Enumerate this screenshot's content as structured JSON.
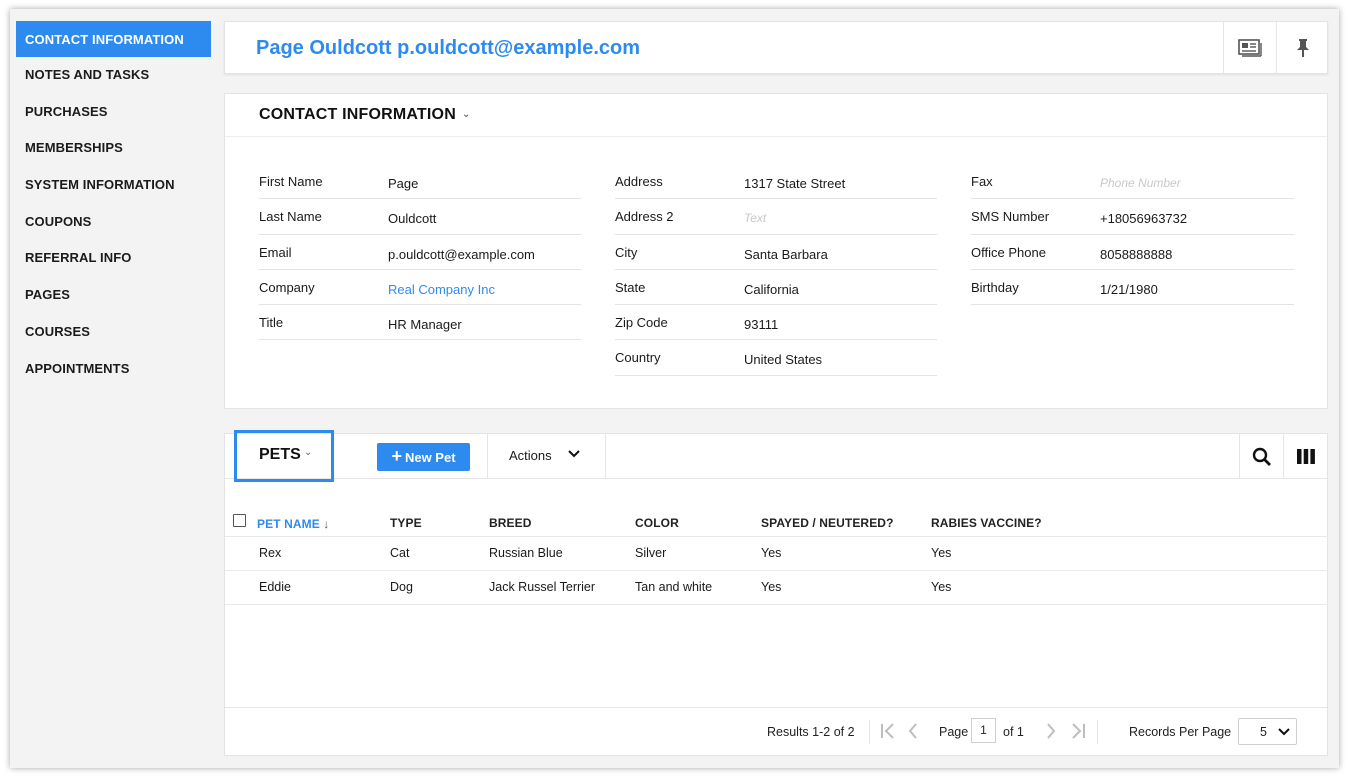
{
  "sidebar": {
    "items": [
      {
        "label": "CONTACT INFORMATION",
        "active": true
      },
      {
        "label": "NOTES AND TASKS"
      },
      {
        "label": "PURCHASES"
      },
      {
        "label": "MEMBERSHIPS"
      },
      {
        "label": "SYSTEM INFORMATION"
      },
      {
        "label": "COUPONS"
      },
      {
        "label": "REFERRAL INFO"
      },
      {
        "label": "PAGES"
      },
      {
        "label": "COURSES"
      },
      {
        "label": "APPOINTMENTS"
      }
    ]
  },
  "header": {
    "title": "Page Ouldcott p.ouldcott@example.com",
    "icons": [
      "contact-card-icon",
      "pin-icon"
    ]
  },
  "contact": {
    "title": "CONTACT INFORMATION",
    "col1": [
      {
        "label": "First Name",
        "value": "Page"
      },
      {
        "label": "Last Name",
        "value": "Ouldcott"
      },
      {
        "label": "Email",
        "value": "p.ouldcott@example.com"
      },
      {
        "label": "Company",
        "value": "Real Company Inc",
        "link": true
      },
      {
        "label": "Title",
        "value": "HR Manager"
      }
    ],
    "col2": [
      {
        "label": "Address",
        "value": "1317 State Street"
      },
      {
        "label": "Address 2",
        "placeholder": "Text"
      },
      {
        "label": "City",
        "value": "Santa Barbara"
      },
      {
        "label": "State",
        "value": "California"
      },
      {
        "label": "Zip Code",
        "value": "93111"
      },
      {
        "label": "Country",
        "value": "United States"
      }
    ],
    "col3": [
      {
        "label": "Fax",
        "placeholder": "Phone Number"
      },
      {
        "label": "SMS Number",
        "value": "+18056963732"
      },
      {
        "label": "Office Phone",
        "value": "8058888888"
      },
      {
        "label": "Birthday",
        "value": "1/21/1980"
      }
    ]
  },
  "pets": {
    "title": "PETS",
    "new_button": "New Pet",
    "actions_label": "Actions",
    "columns": [
      "PET NAME",
      "TYPE",
      "BREED",
      "COLOR",
      "SPAYED / NEUTERED?",
      "RABIES VACCINE?"
    ],
    "sort_indicator": "↓",
    "rows": [
      [
        "Rex",
        "Cat",
        "Russian Blue",
        "Silver",
        "Yes",
        "Yes"
      ],
      [
        "Eddie",
        "Dog",
        "Jack Russel Terrier",
        "Tan and white",
        "Yes",
        "Yes"
      ]
    ]
  },
  "pager": {
    "results": "Results 1-2 of 2",
    "page_label": "Page",
    "page_value": "1",
    "of_label": "of 1",
    "rpp_label": "Records Per Page",
    "rpp_value": "5"
  },
  "colors": {
    "accent": "#2d8bf0"
  }
}
